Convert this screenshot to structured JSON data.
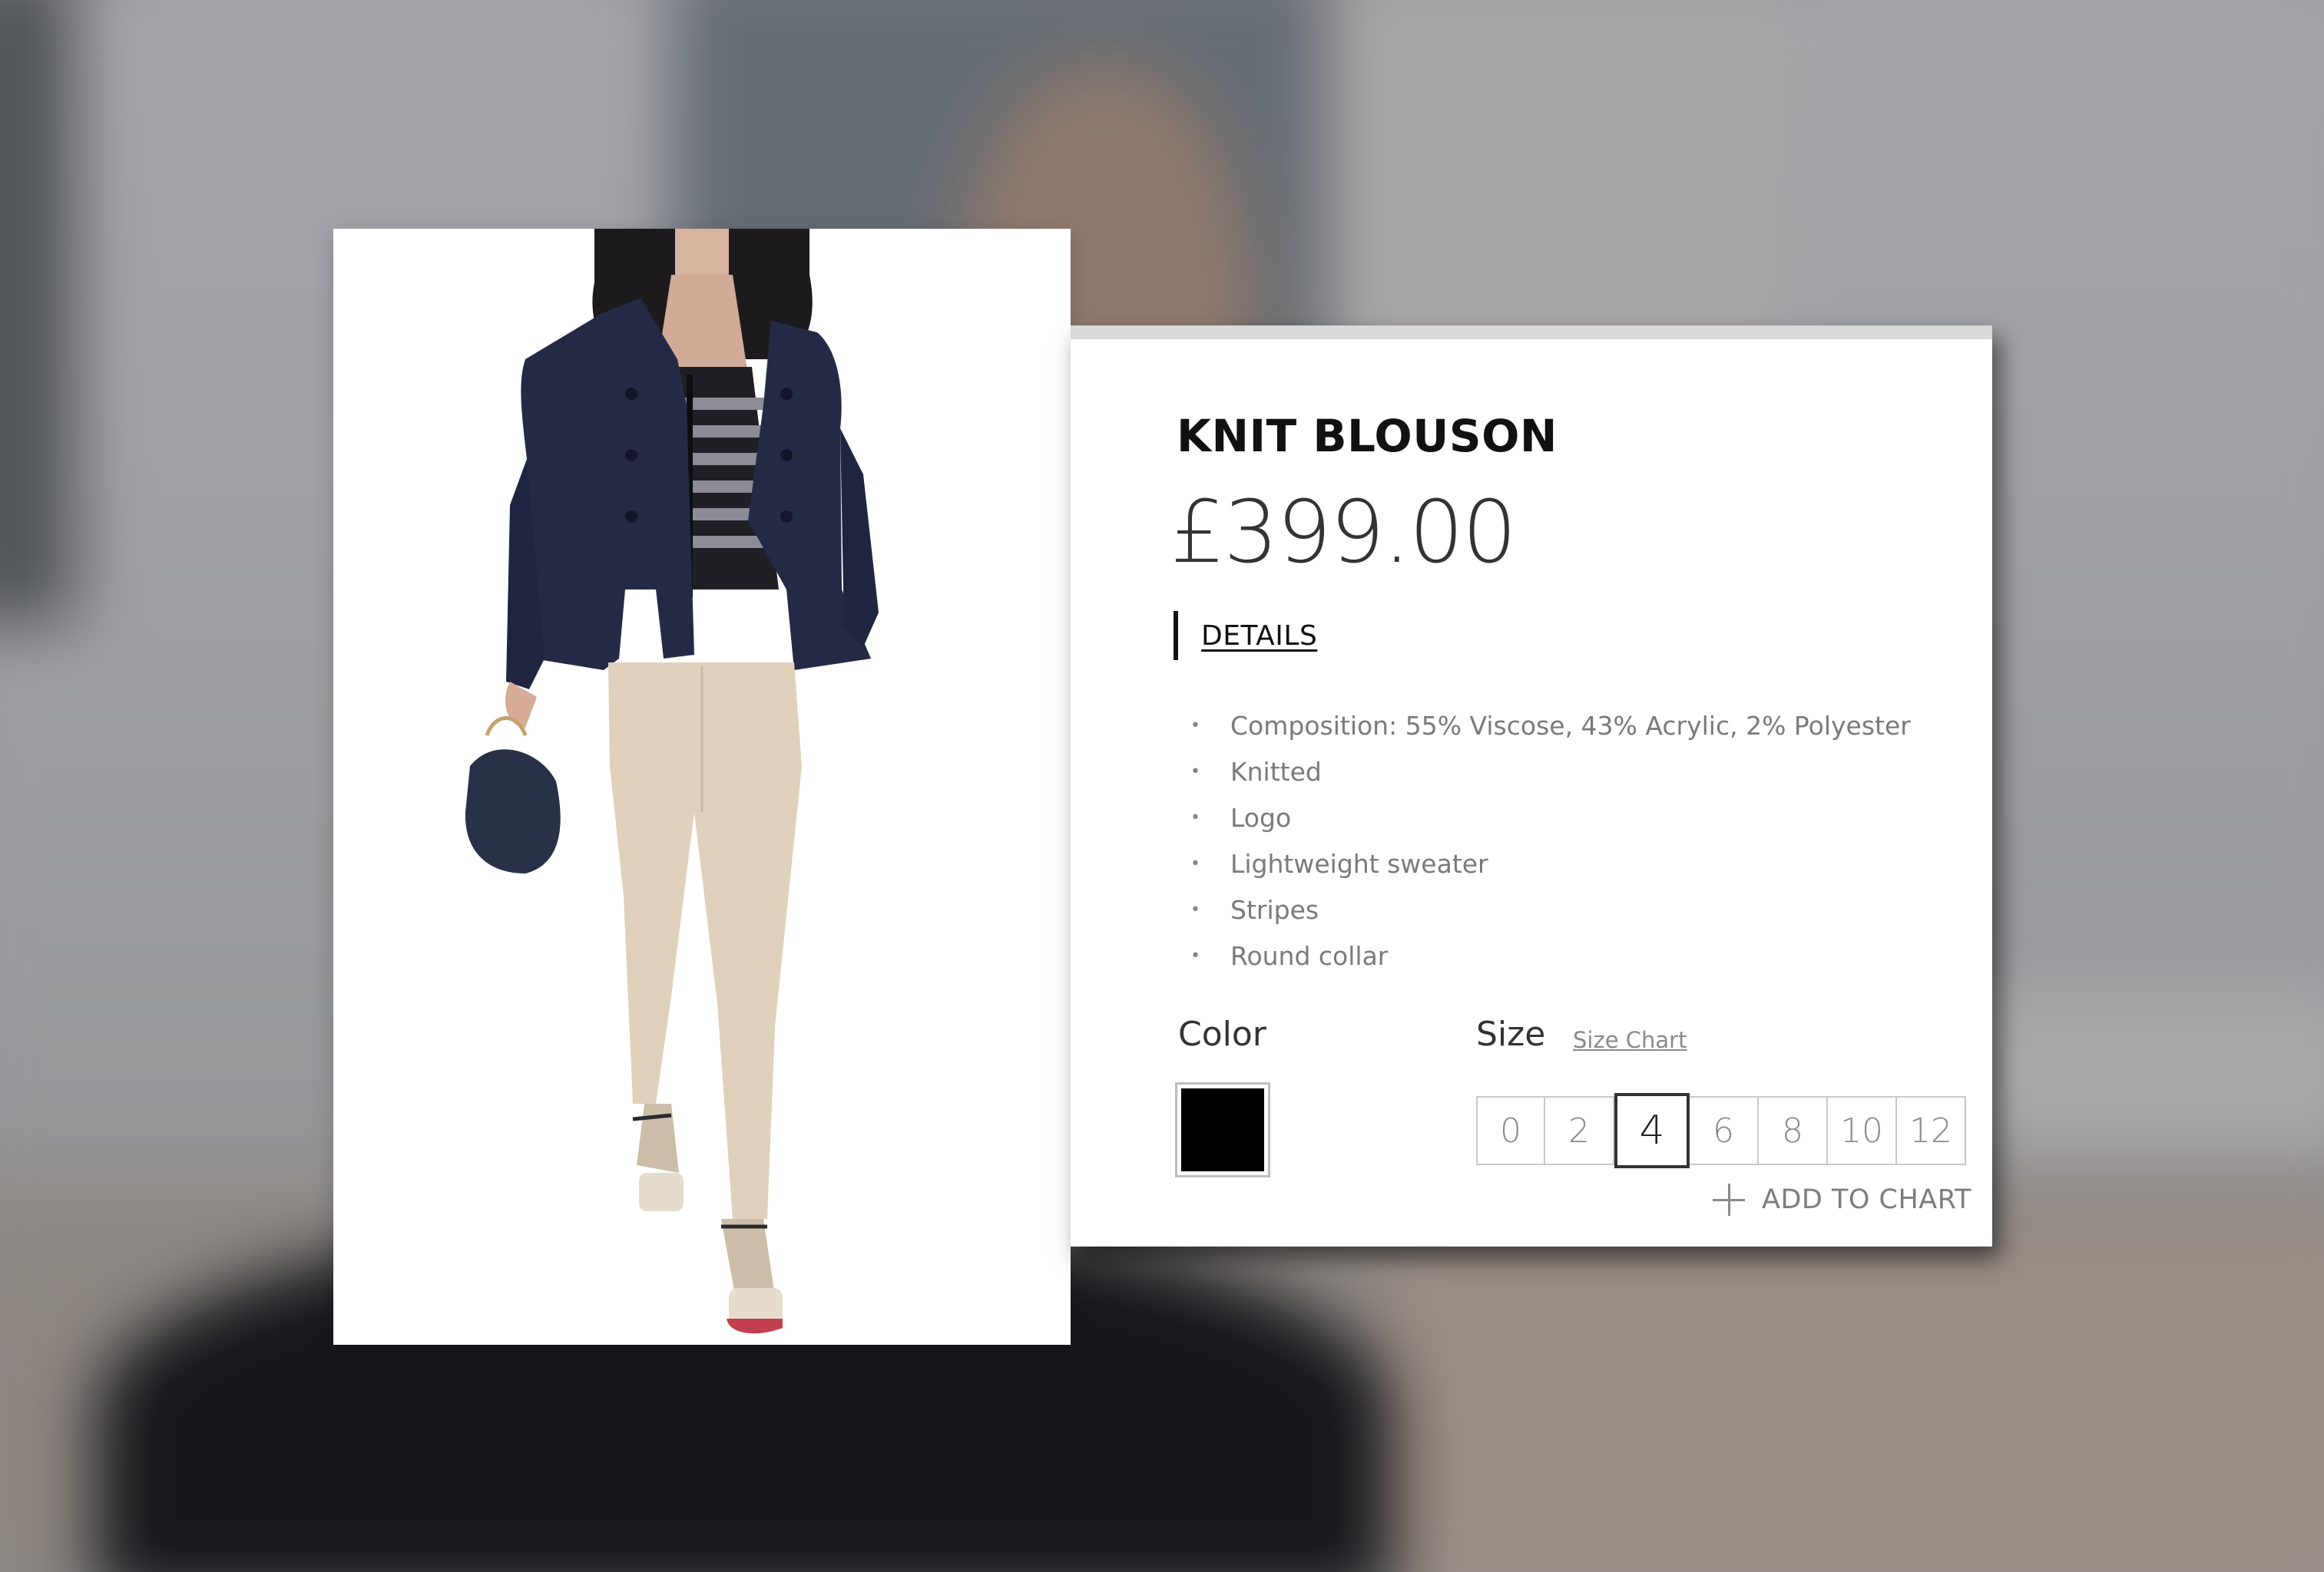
{
  "product": {
    "title": "KNIT BLOUSON",
    "price": "£399.00"
  },
  "details": {
    "tab_label": "DETAILS",
    "items": [
      "Composition:  55% Viscose, 43% Acrylic, 2% Polyester",
      "Knitted",
      "Logo",
      "Lightweight sweater",
      "Stripes",
      "Round collar"
    ],
    "bullet": "•"
  },
  "color": {
    "label": "Color",
    "swatches": [
      {
        "value": "#000000",
        "selected": true
      }
    ]
  },
  "size": {
    "label": "Size",
    "chart_link": "Size Chart",
    "options": [
      "0",
      "2",
      "4",
      "6",
      "8",
      "10",
      "12"
    ],
    "selected": "4"
  },
  "actions": {
    "add_label": "ADD TO CHART",
    "add_icon": "plus-icon"
  },
  "colors": {
    "title": "#111111",
    "price": "#333333",
    "muted_text": "#7a7a7a",
    "panel_bar": "#d9d9d9",
    "size_border": "#c9c9c9",
    "selected_border": "#333333"
  }
}
